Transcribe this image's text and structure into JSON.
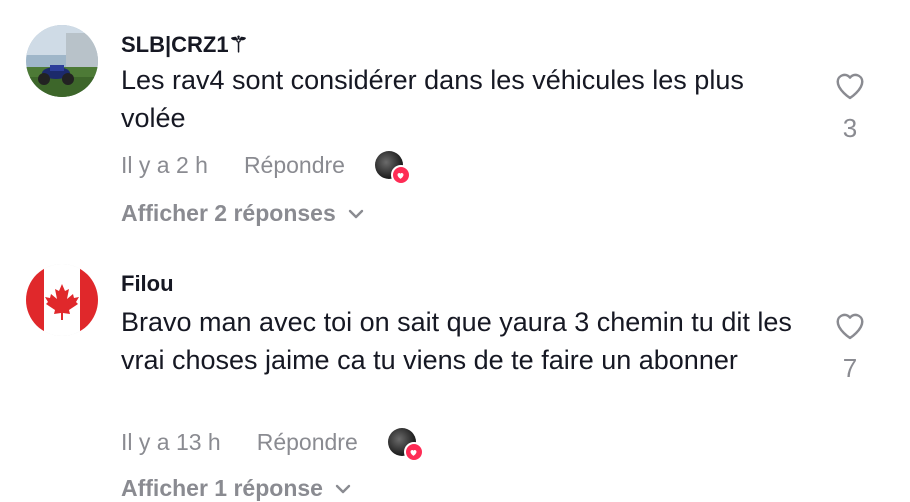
{
  "comments": [
    {
      "username": "SLB|CRZ1⚚",
      "text": "Les rav4 sont considérer dans les véhicules les plus volée",
      "time": "Il y a 2 h",
      "reply_label": "Répondre",
      "like_count": "3",
      "view_replies": "Afficher 2 réponses"
    },
    {
      "username": "Filou",
      "text": "Bravo man avec toi on sait que yaura 3 chemin tu dit les vrai choses jaime ca tu viens de te faire un abonner",
      "time": "Il y a 13 h",
      "reply_label": "Répondre",
      "like_count": "7",
      "view_replies": "Afficher 1 réponse"
    }
  ],
  "colors": {
    "text": "#161823",
    "muted": "#8a8b91",
    "accent": "#fe2c55"
  },
  "icons": [
    "avatar-photo",
    "canada-flag-avatar",
    "heart-icon",
    "chevron-down-icon",
    "creator-liked-badge"
  ]
}
